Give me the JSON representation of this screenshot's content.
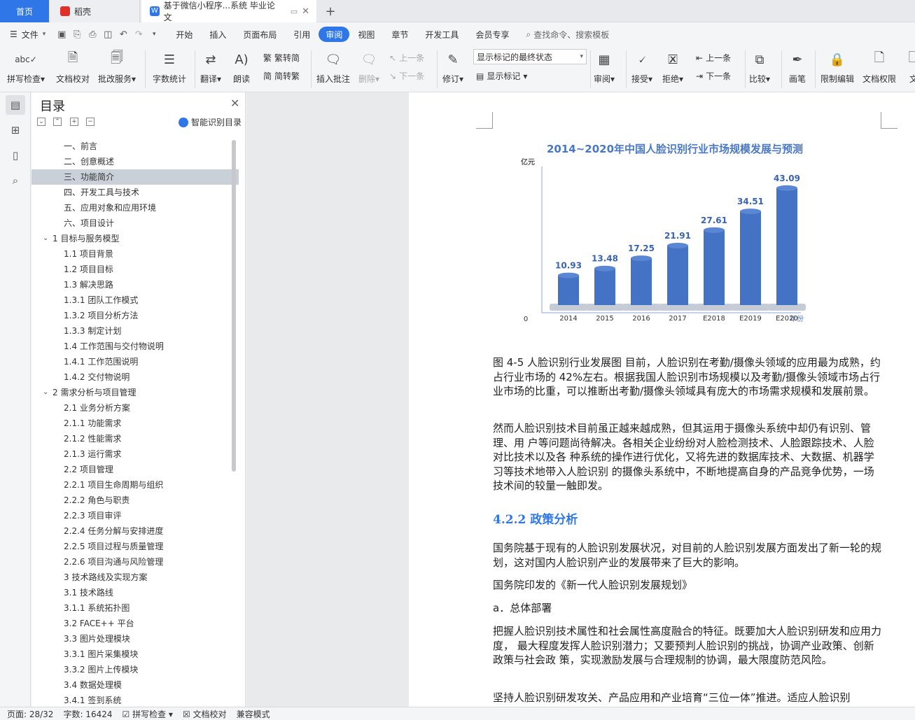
{
  "tabs": {
    "home": "首页",
    "daoke": "稻壳",
    "doc": "基于微信小程序...系统 毕业论文"
  },
  "menu": {
    "file": "文件",
    "items": [
      "开始",
      "插入",
      "页面布局",
      "引用",
      "审阅",
      "视图",
      "章节",
      "开发工具",
      "会员专享"
    ],
    "active": "审阅",
    "search": "查找命令、搜索模板"
  },
  "ribbon": {
    "spellcheck": "拼写检查",
    "doc_proof": "文档校对",
    "annotate_service": "批改服务",
    "word_count": "字数统计",
    "translate": "翻译",
    "read_aloud": "朗读",
    "trad_conv": "繁转简",
    "simp_conv": "简转繁",
    "insert_comment": "插入批注",
    "delete": "删除",
    "prev_comment": "上一条",
    "next_comment": "下一条",
    "revise": "修订",
    "markup_select": "显示标记的最终状态",
    "show_markup": "显示标记",
    "review": "审阅",
    "accept": "接受",
    "reject": "拒绝",
    "prev_change": "上一条",
    "next_change": "下一条",
    "compare": "比较",
    "pen": "画笔",
    "restrict_edit": "限制编辑",
    "doc_permission": "文档权限",
    "more": "文"
  },
  "toc": {
    "title": "目录",
    "smart": "智能识别目录",
    "items": [
      {
        "label": "一、前言",
        "level": 2,
        "selected": false
      },
      {
        "label": "二、创意概述",
        "level": 2,
        "selected": false
      },
      {
        "label": "三、功能简介",
        "level": 2,
        "selected": true
      },
      {
        "label": "四、开发工具与技术",
        "level": 2,
        "selected": false
      },
      {
        "label": "五、应用对象和应用环境",
        "level": 2,
        "selected": false
      },
      {
        "label": "六、项目设计",
        "level": 2,
        "selected": false
      },
      {
        "label": "1 目标与服务模型",
        "level": 1,
        "selected": false
      },
      {
        "label": "1.1 项目背景",
        "level": 2,
        "selected": false
      },
      {
        "label": "1.2 项目目标",
        "level": 2,
        "selected": false
      },
      {
        "label": "1.3 解决思路",
        "level": 2,
        "selected": false
      },
      {
        "label": "1.3.1 团队工作模式",
        "level": 2,
        "selected": false
      },
      {
        "label": "1.3.2 项目分析方法",
        "level": 2,
        "selected": false
      },
      {
        "label": "1.3.3 制定计划",
        "level": 2,
        "selected": false
      },
      {
        "label": "1.4 工作范围与交付物说明",
        "level": 2,
        "selected": false
      },
      {
        "label": "1.4.1 工作范围说明",
        "level": 2,
        "selected": false
      },
      {
        "label": "1.4.2 交付物说明",
        "level": 2,
        "selected": false
      },
      {
        "label": "2 需求分析与项目管理",
        "level": 1,
        "selected": false
      },
      {
        "label": "2.1 业务分析方案",
        "level": 2,
        "selected": false
      },
      {
        "label": "2.1.1 功能需求",
        "level": 2,
        "selected": false
      },
      {
        "label": "2.1.2 性能需求",
        "level": 2,
        "selected": false
      },
      {
        "label": "2.1.3 运行需求",
        "level": 2,
        "selected": false
      },
      {
        "label": "2.2 项目管理",
        "level": 2,
        "selected": false
      },
      {
        "label": "2.2.1 项目生命周期与组织",
        "level": 2,
        "selected": false
      },
      {
        "label": "2.2.2 角色与职责",
        "level": 2,
        "selected": false
      },
      {
        "label": "2.2.3 项目审评",
        "level": 2,
        "selected": false
      },
      {
        "label": "2.2.4 任务分解与安排进度",
        "level": 2,
        "selected": false
      },
      {
        "label": "2.2.5 项目过程与质量管理",
        "level": 2,
        "selected": false
      },
      {
        "label": "2.2.6 项目沟通与风险管理",
        "level": 2,
        "selected": false
      },
      {
        "label": "3 技术路线及实现方案",
        "level": 2,
        "selected": false
      },
      {
        "label": "3.1 技术路线",
        "level": 2,
        "selected": false
      },
      {
        "label": "3.1.1 系统拓扑图",
        "level": 2,
        "selected": false
      },
      {
        "label": "3.2 FACE++ 平台",
        "level": 2,
        "selected": false
      },
      {
        "label": "3.3 图片处理模块",
        "level": 2,
        "selected": false
      },
      {
        "label": "3.3.1 图片采集模块",
        "level": 2,
        "selected": false
      },
      {
        "label": "3.3.2 图片上传模块",
        "level": 2,
        "selected": false
      },
      {
        "label": "3.4 数据处理模 ",
        "level": 2,
        "selected": false
      },
      {
        "label": "3.4.1 签到系统",
        "level": 2,
        "selected": false
      }
    ]
  },
  "chart_data": {
    "type": "bar",
    "title": "2014~2020年中国人脸识别行业市场规模发展与预测",
    "ylabel": "亿元",
    "xlabel": "年份",
    "y_origin_label": "0",
    "categories": [
      "2014",
      "2015",
      "2016",
      "2017",
      "E2018",
      "E2019",
      "E2020"
    ],
    "values": [
      10.93,
      13.48,
      17.25,
      21.91,
      27.61,
      34.51,
      43.09
    ],
    "value_labels": [
      "10.93",
      "13.48",
      "17.25",
      "21.91",
      "27.61",
      "34.51",
      "43.09"
    ],
    "ylim": [
      0,
      50
    ],
    "grid": false,
    "color": "#4472c4"
  },
  "document": {
    "para1": "图 4-5 人脸识别行业发展图 目前，人脸识别在考勤/摄像头领域的应用最为成熟，约占行业市场的 42%左右。根据我国人脸识别市场规模以及考勤/摄像头领域市场占行业市场的比重，可以推断出考勤/摄像头领域具有庞大的市场需求规模和发展前景。",
    "para2": "然而人脸识别技术目前虽正越来越成熟，但其运用于摄像头系统中却仍有识别、管理、用 户等问题尚待解决。各相关企业纷纷对人脸检测技术、人脸跟踪技术、人脸对比技术以及各 种系统的操作进行优化，又将先进的数据库技术、大数据、机器学习等技术地带入人脸识别 的摄像头系统中，不断地提高自身的产品竞争优势，一场技术间的较量一触即发。",
    "heading": "4.2.2 政策分析",
    "para3": "国务院基于现有的人脸识别发展状况，对目前的人脸识别发展方面发出了新一轮的规划，这对国内人脸识别产业的发展带来了巨大的影响。",
    "para4": "国务院印发的《新一代人脸识别发展规划》",
    "para5": "a．总体部署",
    "para6": "把握人脸识别技术属性和社会属性高度融合的特征。既要加大人脸识别研发和应用力度， 最大程度发挥人脸识别潜力；又要预判人脸识别的挑战，协调产业政策、创新政策与社会政 策，实现激励发展与合理规制的协调，最大限度防范风险。",
    "para7": "坚持人脸识别研发攻关、产品应用和产业培育“三位一体”推进。适应人脸识别"
  },
  "status": {
    "page": "页面: 28/32",
    "words": "字数: 16424",
    "spell": "拼写检查",
    "proof": "文档校对",
    "compat": "兼容模式"
  },
  "colors": {
    "accent": "#2f77e8",
    "bar": "#4472c4",
    "chart_title": "#4a78c4"
  }
}
